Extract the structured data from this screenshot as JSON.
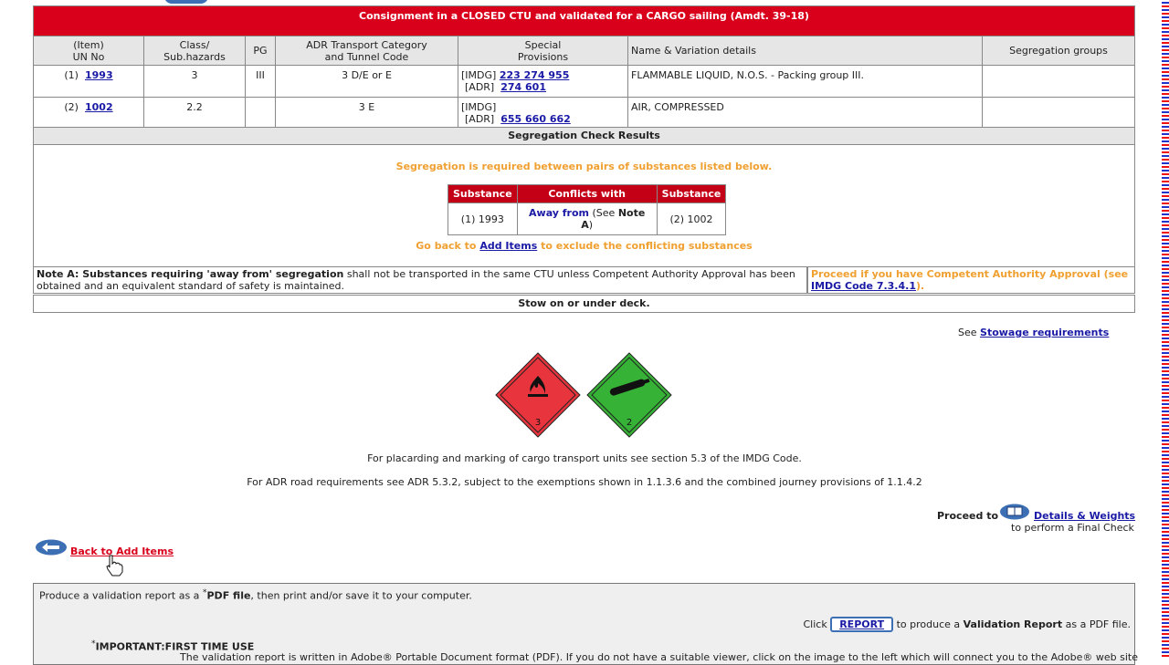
{
  "consignment": {
    "title": "Consignment in a CLOSED CTU and validated for a CARGO sailing (Amdt. 39-18)",
    "headers": {
      "item_line1": "(Item)",
      "item_line2": "UN No",
      "class_line1": "Class/",
      "class_line2": "Sub.hazards",
      "pg": "PG",
      "adr_line1": "ADR Transport Category",
      "adr_line2": "and Tunnel Code",
      "sp_line1": "Special",
      "sp_line2": "Provisions",
      "name": "Name & Variation details",
      "seggroups": "Segregation groups"
    },
    "rows": [
      {
        "item": "(1)",
        "un": "1993",
        "class": "3",
        "pg": "III",
        "adr": "3  D/E or E",
        "imdg_tag": "[IMDG]",
        "imdg_sp": "223 274 955",
        "adr_tag": "[ADR]",
        "adr_sp": "274 601",
        "name": "FLAMMABLE LIQUID, N.O.S. - Packing group III.",
        "seg": ""
      },
      {
        "item": "(2)",
        "un": "1002",
        "class": "2.2",
        "pg": "",
        "adr": "3  E",
        "imdg_tag": "[IMDG]",
        "imdg_sp": "",
        "adr_tag": "[ADR]",
        "adr_sp": "655 660 662",
        "name": "AIR, COMPRESSED",
        "seg": ""
      }
    ]
  },
  "segregation": {
    "title": "Segregation Check Results",
    "required_msg": "Segregation is required between pairs of substances listed below.",
    "table_headers": {
      "sub1": "Substance",
      "conflicts": "Conflicts with",
      "sub2": "Substance"
    },
    "conflict": {
      "sub1": "(1) 1993",
      "link": "Away from",
      "see": "(See",
      "note": "Note A",
      "close": ")",
      "sub2": "(2) 1002"
    },
    "goback_pre": "Go back to",
    "goback_link": "Add Items",
    "goback_post": "to exclude the conflicting substances"
  },
  "noteA": {
    "label": "Note A: Substances requiring 'away from' segregation",
    "text": "shall not be transported in the same CTU unless Competent Authority Approval has been obtained and an equivalent standard of safety is maintained."
  },
  "proceed_auth": {
    "text": "Proceed if you have Competent Authority Approval (see",
    "link": "IMDG Code 7.3.4.1",
    "close": ")."
  },
  "stow": "Stow on or under deck.",
  "stowage": {
    "pre": "See",
    "link": "Stowage requirements"
  },
  "placards": {
    "class3": "3",
    "class2": "2"
  },
  "placarding_text": "For placarding and marking of cargo transport units see section 5.3 of the IMDG Code.",
  "adr_text": "For ADR road requirements see ADR 5.3.2, subject to the exemptions shown in 1.1.3.6 and the combined journey provisions of 1.1.4.2",
  "proceed_to": {
    "label": "Proceed to",
    "link": "Details & Weights",
    "sub": "to perform a Final Check"
  },
  "back_link": "Back to Add Items",
  "report": {
    "intro_pre": "Produce a validation report as a",
    "star": "*",
    "pdf": "PDF file",
    "intro_post": ", then print and/or save it to your computer.",
    "click": "Click",
    "button": "REPORT",
    "after_pre": "to produce a",
    "after_bold": "Validation Report",
    "after_post": "as a PDF file.",
    "important": "IMPORTANT:FIRST TIME USE",
    "partial": "The validation report is written in Adobe® Portable Document format (PDF). If you do not have a suitable viewer, click on the image to the left which will connect you to the Adobe® web site"
  },
  "colors": {
    "title_red": "#d9001b",
    "orange": "#f0a030",
    "link": "#1a1aa6",
    "placard_red": "#e8343c",
    "placard_green": "#36b336"
  }
}
